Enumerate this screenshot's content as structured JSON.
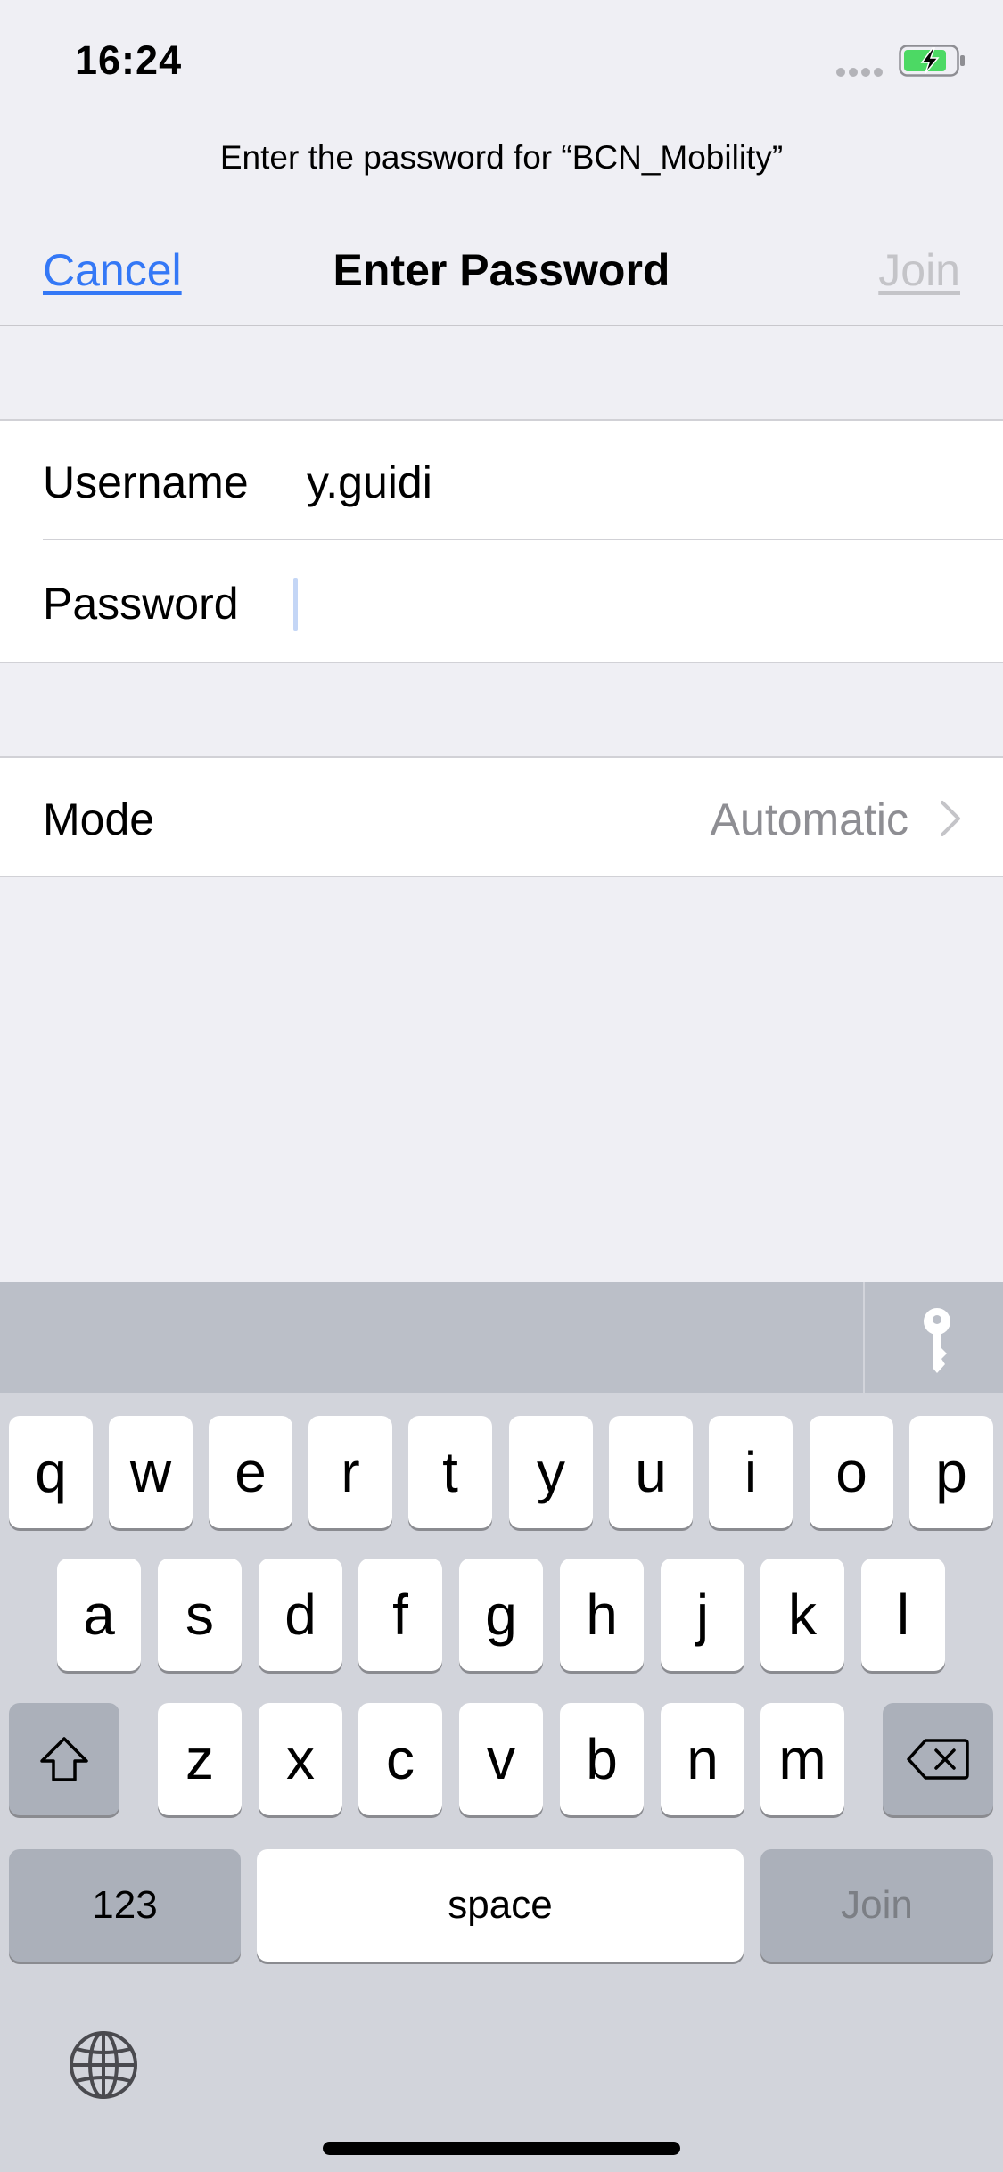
{
  "status_bar": {
    "time": "16:24",
    "battery_icon": "battery-charging-icon",
    "battery_color": "#4cd964"
  },
  "prompt": "Enter the password for “BCN_Mobility”",
  "nav": {
    "cancel_label": "Cancel",
    "title": "Enter Password",
    "join_label": "Join"
  },
  "form": {
    "username_label": "Username",
    "username_value": "y.guidi",
    "password_label": "Password",
    "password_value": ""
  },
  "mode": {
    "label": "Mode",
    "value": "Automatic",
    "icon": "chevron-right-icon"
  },
  "keyboard": {
    "toolbar_icon": "key-icon",
    "row1": [
      "q",
      "w",
      "e",
      "r",
      "t",
      "y",
      "u",
      "i",
      "o",
      "p"
    ],
    "row2": [
      "a",
      "s",
      "d",
      "f",
      "g",
      "h",
      "j",
      "k",
      "l"
    ],
    "row3": [
      "z",
      "x",
      "c",
      "v",
      "b",
      "n",
      "m"
    ],
    "shift_icon": "shift-icon",
    "delete_icon": "delete-icon",
    "numbers_label": "123",
    "space_label": "space",
    "join_label": "Join",
    "globe_icon": "globe-icon"
  },
  "colors": {
    "accent": "#3478f6",
    "disabled": "#c4c4c8",
    "background": "#efeff4",
    "keyboard_bg": "#d2d4db"
  }
}
